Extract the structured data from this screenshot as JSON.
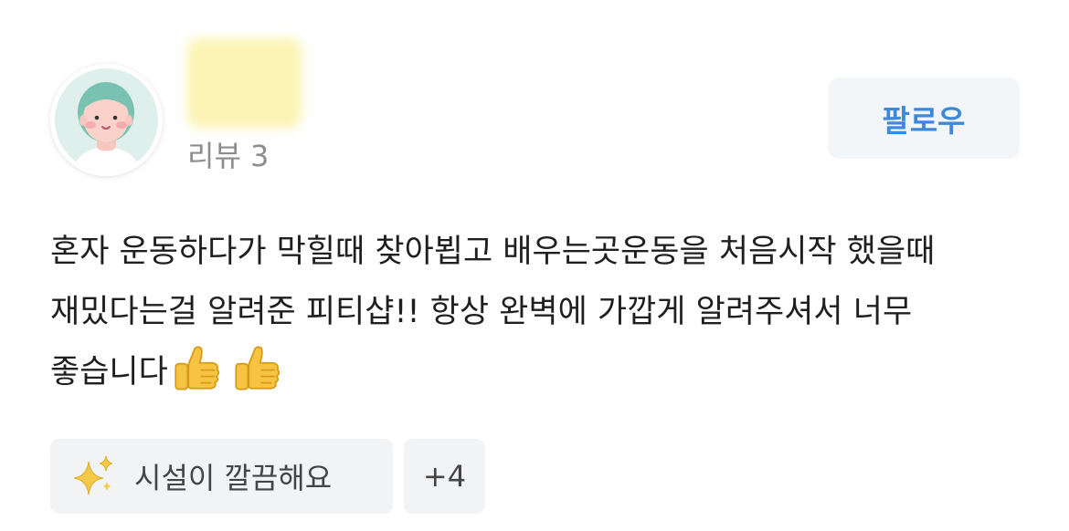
{
  "review": {
    "author_name": "",
    "review_count_label": "리뷰 3",
    "follow_label": "팔로우",
    "text": "혼자 운동하다가 막힐때 찾아뵙고 배우는곳운동을 처음시작 했을때 재밌다는걸 알려준 피티샵!! 항상 완벽에 가깝게 알려주셔서 너무 좋습니다",
    "emojis": [
      "thumbs-up",
      "thumbs-up"
    ]
  },
  "tags": {
    "main_label": "시설이 깔끔해요",
    "main_icon": "sparkles-icon",
    "more_label": "+4"
  },
  "colors": {
    "follow_text": "#3d88d8",
    "follow_bg": "#f3f6f9",
    "tag_bg": "#f2f3f5",
    "meta_text": "#8d8d8d"
  }
}
